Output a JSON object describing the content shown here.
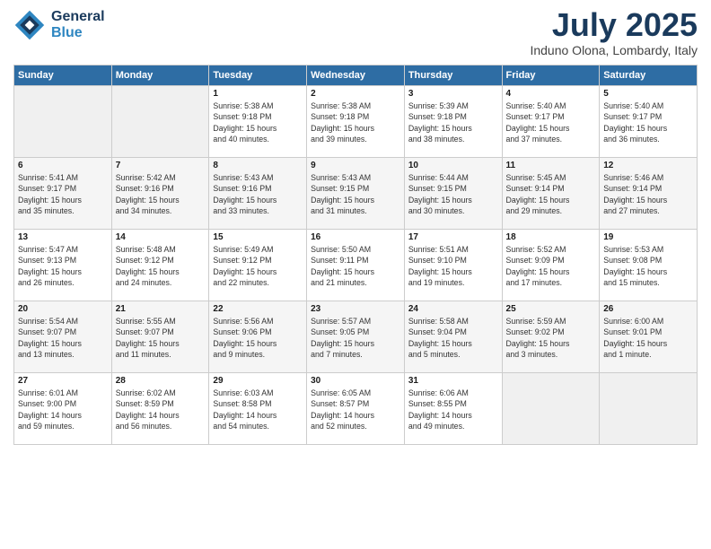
{
  "app": {
    "logo_line1": "General",
    "logo_line2": "Blue",
    "month_title": "July 2025",
    "location": "Induno Olona, Lombardy, Italy"
  },
  "weekdays": [
    "Sunday",
    "Monday",
    "Tuesday",
    "Wednesday",
    "Thursday",
    "Friday",
    "Saturday"
  ],
  "weeks": [
    [
      {
        "day": "",
        "info": ""
      },
      {
        "day": "",
        "info": ""
      },
      {
        "day": "1",
        "info": "Sunrise: 5:38 AM\nSunset: 9:18 PM\nDaylight: 15 hours\nand 40 minutes."
      },
      {
        "day": "2",
        "info": "Sunrise: 5:38 AM\nSunset: 9:18 PM\nDaylight: 15 hours\nand 39 minutes."
      },
      {
        "day": "3",
        "info": "Sunrise: 5:39 AM\nSunset: 9:18 PM\nDaylight: 15 hours\nand 38 minutes."
      },
      {
        "day": "4",
        "info": "Sunrise: 5:40 AM\nSunset: 9:17 PM\nDaylight: 15 hours\nand 37 minutes."
      },
      {
        "day": "5",
        "info": "Sunrise: 5:40 AM\nSunset: 9:17 PM\nDaylight: 15 hours\nand 36 minutes."
      }
    ],
    [
      {
        "day": "6",
        "info": "Sunrise: 5:41 AM\nSunset: 9:17 PM\nDaylight: 15 hours\nand 35 minutes."
      },
      {
        "day": "7",
        "info": "Sunrise: 5:42 AM\nSunset: 9:16 PM\nDaylight: 15 hours\nand 34 minutes."
      },
      {
        "day": "8",
        "info": "Sunrise: 5:43 AM\nSunset: 9:16 PM\nDaylight: 15 hours\nand 33 minutes."
      },
      {
        "day": "9",
        "info": "Sunrise: 5:43 AM\nSunset: 9:15 PM\nDaylight: 15 hours\nand 31 minutes."
      },
      {
        "day": "10",
        "info": "Sunrise: 5:44 AM\nSunset: 9:15 PM\nDaylight: 15 hours\nand 30 minutes."
      },
      {
        "day": "11",
        "info": "Sunrise: 5:45 AM\nSunset: 9:14 PM\nDaylight: 15 hours\nand 29 minutes."
      },
      {
        "day": "12",
        "info": "Sunrise: 5:46 AM\nSunset: 9:14 PM\nDaylight: 15 hours\nand 27 minutes."
      }
    ],
    [
      {
        "day": "13",
        "info": "Sunrise: 5:47 AM\nSunset: 9:13 PM\nDaylight: 15 hours\nand 26 minutes."
      },
      {
        "day": "14",
        "info": "Sunrise: 5:48 AM\nSunset: 9:12 PM\nDaylight: 15 hours\nand 24 minutes."
      },
      {
        "day": "15",
        "info": "Sunrise: 5:49 AM\nSunset: 9:12 PM\nDaylight: 15 hours\nand 22 minutes."
      },
      {
        "day": "16",
        "info": "Sunrise: 5:50 AM\nSunset: 9:11 PM\nDaylight: 15 hours\nand 21 minutes."
      },
      {
        "day": "17",
        "info": "Sunrise: 5:51 AM\nSunset: 9:10 PM\nDaylight: 15 hours\nand 19 minutes."
      },
      {
        "day": "18",
        "info": "Sunrise: 5:52 AM\nSunset: 9:09 PM\nDaylight: 15 hours\nand 17 minutes."
      },
      {
        "day": "19",
        "info": "Sunrise: 5:53 AM\nSunset: 9:08 PM\nDaylight: 15 hours\nand 15 minutes."
      }
    ],
    [
      {
        "day": "20",
        "info": "Sunrise: 5:54 AM\nSunset: 9:07 PM\nDaylight: 15 hours\nand 13 minutes."
      },
      {
        "day": "21",
        "info": "Sunrise: 5:55 AM\nSunset: 9:07 PM\nDaylight: 15 hours\nand 11 minutes."
      },
      {
        "day": "22",
        "info": "Sunrise: 5:56 AM\nSunset: 9:06 PM\nDaylight: 15 hours\nand 9 minutes."
      },
      {
        "day": "23",
        "info": "Sunrise: 5:57 AM\nSunset: 9:05 PM\nDaylight: 15 hours\nand 7 minutes."
      },
      {
        "day": "24",
        "info": "Sunrise: 5:58 AM\nSunset: 9:04 PM\nDaylight: 15 hours\nand 5 minutes."
      },
      {
        "day": "25",
        "info": "Sunrise: 5:59 AM\nSunset: 9:02 PM\nDaylight: 15 hours\nand 3 minutes."
      },
      {
        "day": "26",
        "info": "Sunrise: 6:00 AM\nSunset: 9:01 PM\nDaylight: 15 hours\nand 1 minute."
      }
    ],
    [
      {
        "day": "27",
        "info": "Sunrise: 6:01 AM\nSunset: 9:00 PM\nDaylight: 14 hours\nand 59 minutes."
      },
      {
        "day": "28",
        "info": "Sunrise: 6:02 AM\nSunset: 8:59 PM\nDaylight: 14 hours\nand 56 minutes."
      },
      {
        "day": "29",
        "info": "Sunrise: 6:03 AM\nSunset: 8:58 PM\nDaylight: 14 hours\nand 54 minutes."
      },
      {
        "day": "30",
        "info": "Sunrise: 6:05 AM\nSunset: 8:57 PM\nDaylight: 14 hours\nand 52 minutes."
      },
      {
        "day": "31",
        "info": "Sunrise: 6:06 AM\nSunset: 8:55 PM\nDaylight: 14 hours\nand 49 minutes."
      },
      {
        "day": "",
        "info": ""
      },
      {
        "day": "",
        "info": ""
      }
    ]
  ]
}
